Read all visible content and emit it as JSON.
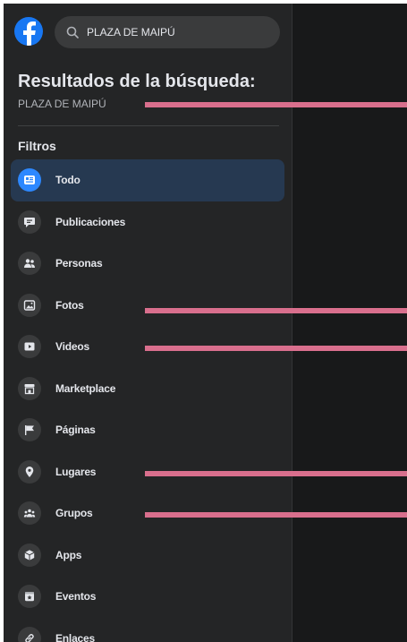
{
  "search": {
    "value": "PLAZA DE MAIPÚ"
  },
  "results": {
    "title": "Resultados de la búsqueda:",
    "query": "PLAZA DE MAIPÚ"
  },
  "filters": {
    "heading": "Filtros",
    "items": [
      {
        "label": "Todo",
        "icon": "feed-icon",
        "active": true
      },
      {
        "label": "Publicaciones",
        "icon": "chat-bubble-icon"
      },
      {
        "label": "Personas",
        "icon": "people-icon"
      },
      {
        "label": "Fotos",
        "icon": "photo-icon"
      },
      {
        "label": "Videos",
        "icon": "video-icon"
      },
      {
        "label": "Marketplace",
        "icon": "storefront-icon"
      },
      {
        "label": "Páginas",
        "icon": "flag-icon"
      },
      {
        "label": "Lugares",
        "icon": "location-pin-icon"
      },
      {
        "label": "Grupos",
        "icon": "groups-icon"
      },
      {
        "label": "Apps",
        "icon": "cube-icon"
      },
      {
        "label": "Eventos",
        "icon": "calendar-star-icon"
      },
      {
        "label": "Enlaces",
        "icon": "link-icon"
      }
    ]
  },
  "colors": {
    "accent": "#2d88ff",
    "annotation": "#d96f8d",
    "sidebar_bg": "#242526",
    "page_bg": "#18191a"
  }
}
